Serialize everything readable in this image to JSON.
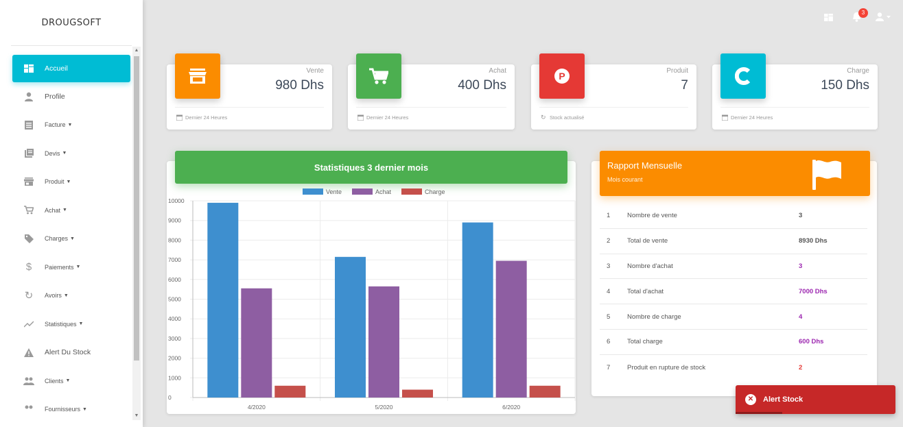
{
  "app": {
    "brand": "DROUGSOFT"
  },
  "sidebar": {
    "items": [
      {
        "label": "Accueil",
        "icon": "dashboard-icon",
        "active": true
      },
      {
        "label": "Profile",
        "icon": "person-icon"
      },
      {
        "label": "Facture",
        "icon": "invoice-icon",
        "dropdown": true
      },
      {
        "label": "Devis",
        "icon": "quote-icon",
        "dropdown": true
      },
      {
        "label": "Produit",
        "icon": "store-icon",
        "dropdown": true
      },
      {
        "label": "Achat",
        "icon": "cart-icon",
        "dropdown": true
      },
      {
        "label": "Charges",
        "icon": "tag-icon",
        "dropdown": true
      },
      {
        "label": "Paiements",
        "icon": "dollar-icon",
        "dropdown": true
      },
      {
        "label": "Avoirs",
        "icon": "refresh-icon",
        "dropdown": true
      },
      {
        "label": "Statistiques",
        "icon": "trend-icon",
        "dropdown": true
      },
      {
        "label": "Alert Du Stock",
        "icon": "warning-icon"
      },
      {
        "label": "Clients",
        "icon": "people-icon",
        "dropdown": true
      },
      {
        "label": "Fournisseurs",
        "icon": "people-icon",
        "dropdown": true
      }
    ]
  },
  "topbar": {
    "notification_count": "3"
  },
  "stats": [
    {
      "label": "Vente",
      "value": "980 Dhs",
      "footer": "Dernier 24 Heures",
      "color": "#fb8c00",
      "icon": "store-icon",
      "footer_icon": "calendar-icon"
    },
    {
      "label": "Achat",
      "value": "400 Dhs",
      "footer": "Dernier 24 Heures",
      "color": "#4caf50",
      "icon": "cart-icon",
      "footer_icon": "calendar-icon"
    },
    {
      "label": "Produit",
      "value": "7",
      "footer": "Stock actualisé",
      "color": "#e53935",
      "icon": "product-icon",
      "footer_icon": "refresh-icon"
    },
    {
      "label": "Charge",
      "value": "150 Dhs",
      "footer": "Dernier 24 Heures",
      "color": "#00bcd4",
      "icon": "charge-icon",
      "footer_icon": "calendar-icon"
    }
  ],
  "chart_header": "Statistiques 3 dernier mois",
  "chart_data": {
    "type": "bar",
    "categories": [
      "4/2020",
      "5/2020",
      "6/2020"
    ],
    "series": [
      {
        "name": "Vente",
        "color": "#3e8fcf",
        "values": [
          9900,
          7150,
          8900
        ]
      },
      {
        "name": "Achat",
        "color": "#8e5ea2",
        "values": [
          5550,
          5650,
          6950
        ]
      },
      {
        "name": "Charge",
        "color": "#c5504b",
        "values": [
          600,
          400,
          600
        ]
      }
    ],
    "yticks": [
      "10000",
      "9000",
      "8000",
      "7000",
      "6000",
      "5000",
      "4000",
      "3000",
      "2000",
      "1000",
      "0"
    ],
    "ylim": [
      0,
      10000
    ],
    "legend": "top",
    "grid": true
  },
  "report": {
    "title": "Rapport Mensuelle",
    "subtitle": "Mois courant",
    "rows": [
      {
        "n": "1",
        "label": "Nombre de vente",
        "value": "3",
        "color": "#555555"
      },
      {
        "n": "2",
        "label": "Total de vente",
        "value": "8930 Dhs",
        "color": "#555555"
      },
      {
        "n": "3",
        "label": "Nombre d'achat",
        "value": "3",
        "color": "#9c27b0"
      },
      {
        "n": "4",
        "label": "Total d'achat",
        "value": "7000 Dhs",
        "color": "#9c27b0"
      },
      {
        "n": "5",
        "label": "Nombre de charge",
        "value": "4",
        "color": "#9c27b0"
      },
      {
        "n": "6",
        "label": "Total charge",
        "value": "600 Dhs",
        "color": "#9c27b0"
      },
      {
        "n": "7",
        "label": "Produit en rupture de stock",
        "value": "2",
        "color": "#e53935"
      }
    ]
  },
  "alert": {
    "label": "Alert Stock"
  }
}
